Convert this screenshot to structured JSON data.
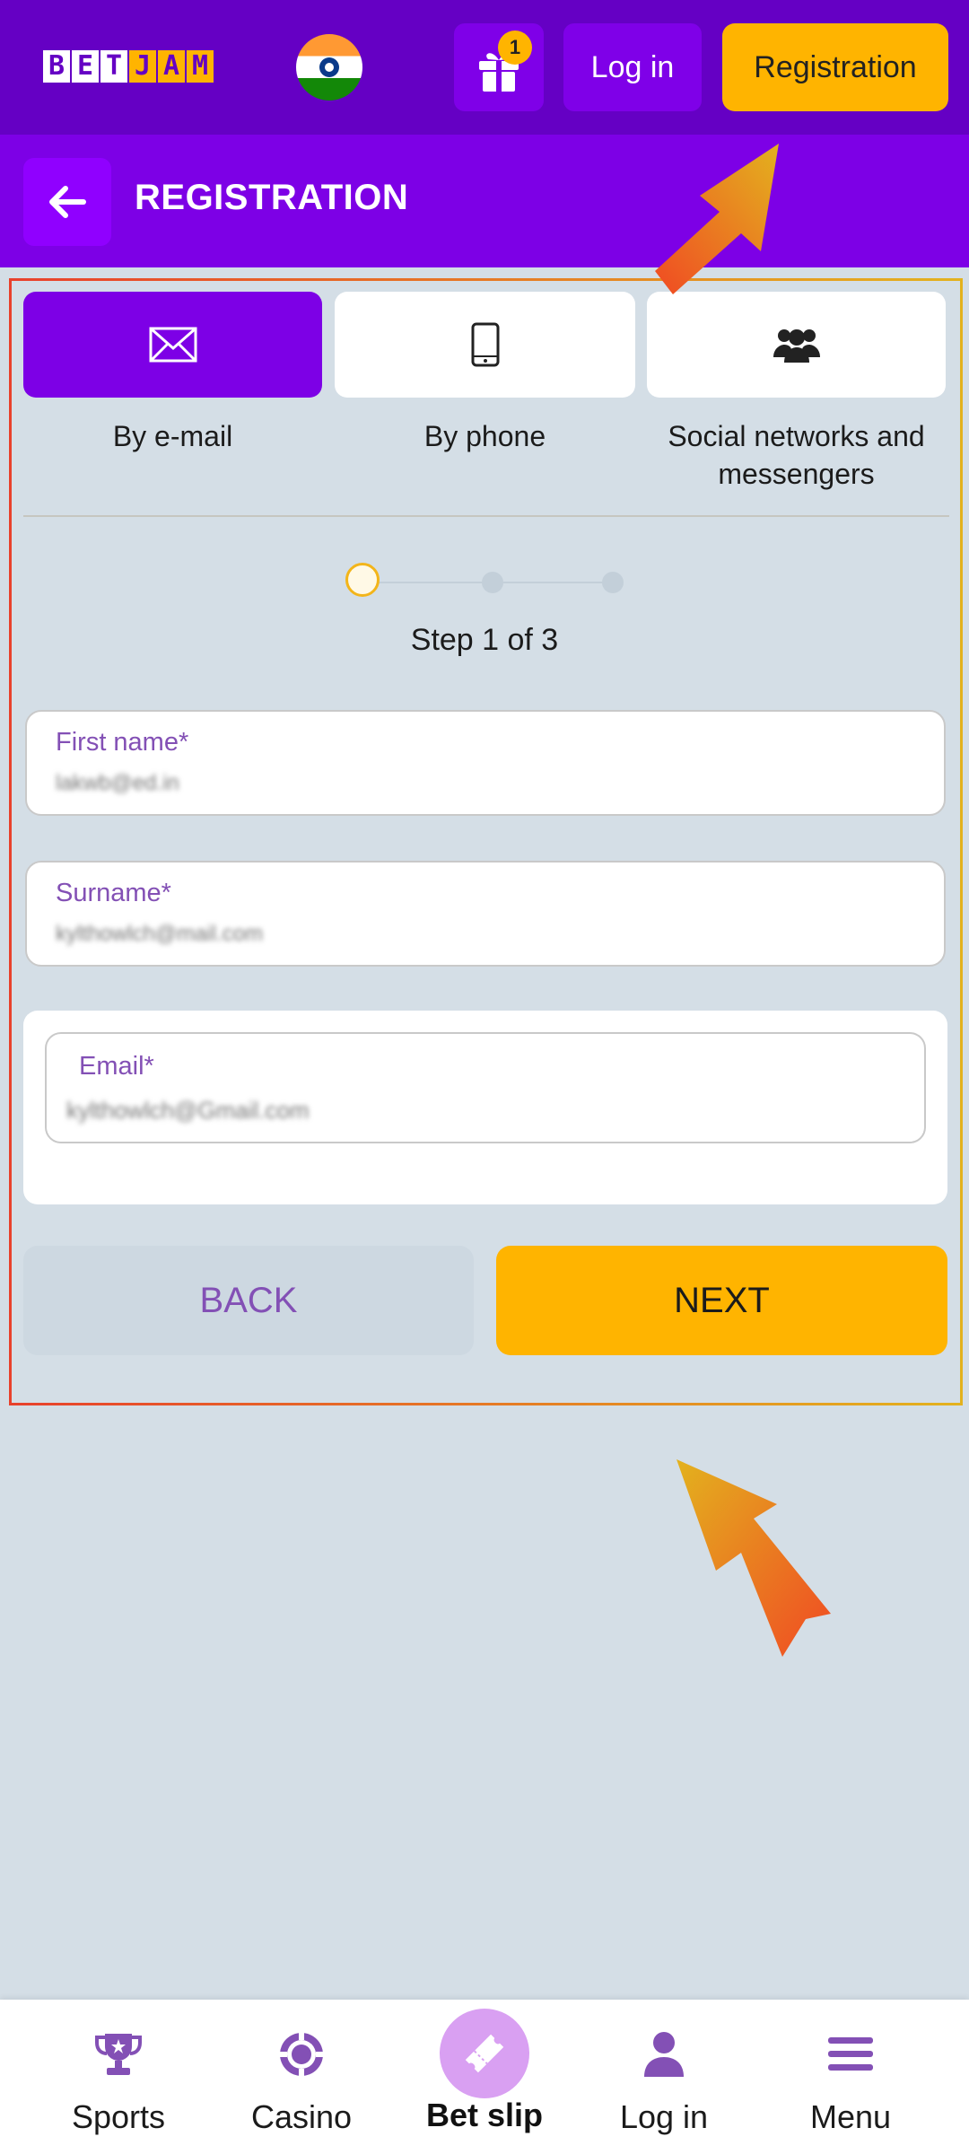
{
  "header": {
    "logo_letters": [
      "B",
      "E",
      "T",
      "J",
      "A",
      "M"
    ],
    "flag_icon": "india-flag-icon",
    "gift_icon": "gift-icon",
    "gift_badge_count": "1",
    "login_label": "Log in",
    "registration_label": "Registration"
  },
  "titlebar": {
    "back_icon": "arrow-left-icon",
    "title": "REGISTRATION"
  },
  "methods": [
    {
      "label": "By e-mail",
      "icon": "envelope-icon",
      "active": true
    },
    {
      "label": "By phone",
      "icon": "smartphone-icon",
      "active": false
    },
    {
      "label": "Social networks and messengers",
      "icon": "users-group-icon",
      "active": false
    }
  ],
  "stepper": {
    "current_step": 1,
    "total_steps": 3,
    "text": "Step 1 of 3"
  },
  "form": {
    "first_name": {
      "label": "First name*",
      "value": "lakwb@ed.in"
    },
    "surname": {
      "label": "Surname*",
      "value": "kylthowlch@mail.com"
    },
    "email": {
      "label": "Email*",
      "value": "kylthowlch@Gmail.com"
    }
  },
  "actions": {
    "back_label": "BACK",
    "next_label": "NEXT"
  },
  "bottom_nav": [
    {
      "label": "Sports",
      "icon": "trophy-icon"
    },
    {
      "label": "Casino",
      "icon": "casino-chip-icon"
    },
    {
      "label": "Bet slip",
      "icon": "ticket-icon"
    },
    {
      "label": "Log in",
      "icon": "user-icon"
    },
    {
      "label": "Menu",
      "icon": "hamburger-menu-icon"
    }
  ],
  "colors": {
    "header_purple": "#6500c4",
    "title_purple": "#7d00e6",
    "accent_yellow": "#ffb400",
    "background": "#d4dee6",
    "label_purple": "#8350b5"
  }
}
